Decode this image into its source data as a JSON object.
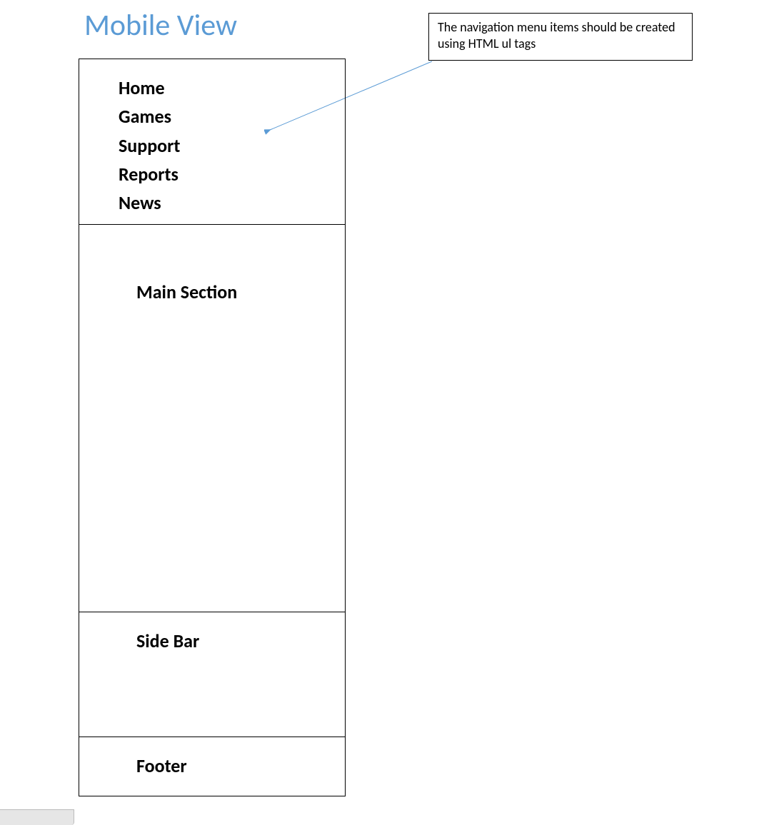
{
  "title": "Mobile View",
  "annotation": "The navigation menu items should be created using HTML ul tags",
  "nav": {
    "items": [
      {
        "label": "Home"
      },
      {
        "label": "Games"
      },
      {
        "label": "Support"
      },
      {
        "label": "Reports"
      },
      {
        "label": "News"
      }
    ]
  },
  "sections": {
    "main_label": "Main Section",
    "sidebar_label": "Side Bar",
    "footer_label": "Footer"
  },
  "colors": {
    "title": "#5b9bd5",
    "arrow": "#5b9bd5"
  }
}
